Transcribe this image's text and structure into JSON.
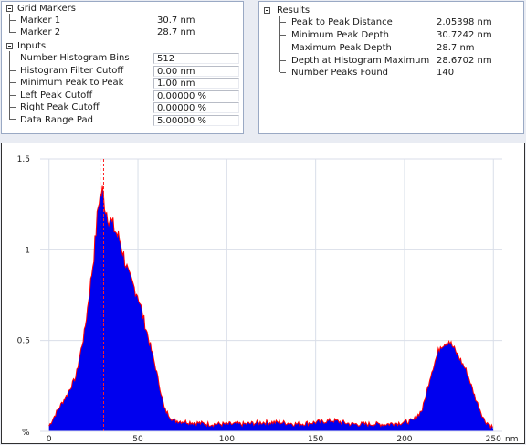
{
  "grid_markers": {
    "title": "Grid Markers",
    "items": [
      {
        "label": "Marker 1",
        "value": "30.7 nm"
      },
      {
        "label": "Marker 2",
        "value": "28.7 nm"
      }
    ]
  },
  "inputs": {
    "title": "Inputs",
    "items": [
      {
        "label": "Number Histogram Bins",
        "value": "512"
      },
      {
        "label": "Histogram Filter Cutoff",
        "value": "0.00 nm"
      },
      {
        "label": "Minimum Peak to Peak",
        "value": "1.00 nm"
      },
      {
        "label": "Left Peak Cutoff",
        "value": "0.00000 %"
      },
      {
        "label": "Right Peak Cutoff",
        "value": "0.00000 %"
      },
      {
        "label": "Data Range Pad",
        "value": "5.00000 %"
      }
    ]
  },
  "results": {
    "title": "Results",
    "items": [
      {
        "label": "Peak to Peak Distance",
        "value": "2.05398 nm"
      },
      {
        "label": "Minimum Peak Depth",
        "value": "30.7242 nm"
      },
      {
        "label": "Maximum Peak Depth",
        "value": "28.7 nm"
      },
      {
        "label": "Depth at Histogram Maximum",
        "value": "28.6702 nm"
      },
      {
        "label": "Number Peaks Found",
        "value": "140"
      }
    ]
  },
  "chart_data": {
    "type": "bar",
    "title": "",
    "xlabel": "nm",
    "ylabel": "%",
    "xlim": [
      -5,
      255
    ],
    "ylim": [
      0,
      1.5
    ],
    "x_ticks": [
      0,
      50,
      100,
      150,
      200,
      250
    ],
    "y_ticks": [
      {
        "value": 0.5,
        "label": "0.5"
      },
      {
        "value": 1,
        "label": "1"
      },
      {
        "value": 1.5,
        "label": "1.5"
      }
    ],
    "y_origin_label": "%",
    "grid": true,
    "markers": [
      28.7,
      30.7
    ],
    "series": [
      {
        "fill_color": "#0000ee",
        "outline_color": "#ff0000",
        "x": [
          0,
          5,
          10,
          15,
          20,
          25,
          28,
          30,
          32,
          35,
          40,
          45,
          50,
          55,
          60,
          65,
          70,
          80,
          90,
          100,
          110,
          120,
          130,
          140,
          150,
          160,
          170,
          180,
          190,
          200,
          205,
          210,
          215,
          220,
          225,
          230,
          235,
          240,
          245,
          250
        ],
        "values": [
          0.03,
          0.12,
          0.2,
          0.3,
          0.55,
          0.95,
          1.28,
          1.32,
          1.22,
          1.15,
          1.05,
          0.85,
          0.75,
          0.55,
          0.35,
          0.12,
          0.06,
          0.05,
          0.04,
          0.04,
          0.04,
          0.05,
          0.05,
          0.04,
          0.05,
          0.06,
          0.04,
          0.04,
          0.04,
          0.05,
          0.06,
          0.12,
          0.32,
          0.47,
          0.5,
          0.42,
          0.33,
          0.18,
          0.06,
          0.02
        ]
      }
    ]
  }
}
